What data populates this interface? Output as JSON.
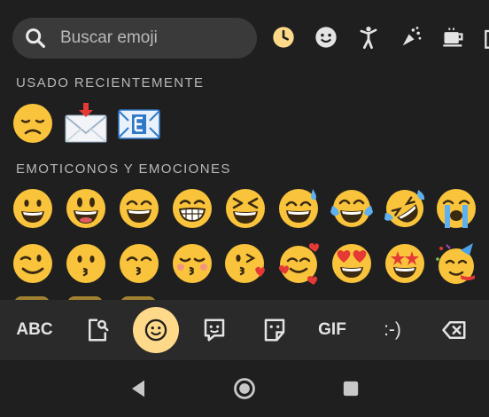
{
  "search": {
    "placeholder": "Buscar emoji"
  },
  "categories": [
    "recent-icon",
    "smiley-icon",
    "person-icon",
    "activity-icon",
    "food-icon",
    "more-icon"
  ],
  "sections": {
    "recent": "USADO RECIENTEMENTE",
    "emotions": "EMOTICONOS Y EMOCIONES"
  },
  "toolbar": {
    "abc": "ABC",
    "gif": "GIF",
    "emoticon": ":-)"
  },
  "colors": {
    "accent": "#ffd98a",
    "emoji_yellow": "#f9c43c",
    "background": "#1f1f1f",
    "toolbar": "#2a2a2a"
  }
}
